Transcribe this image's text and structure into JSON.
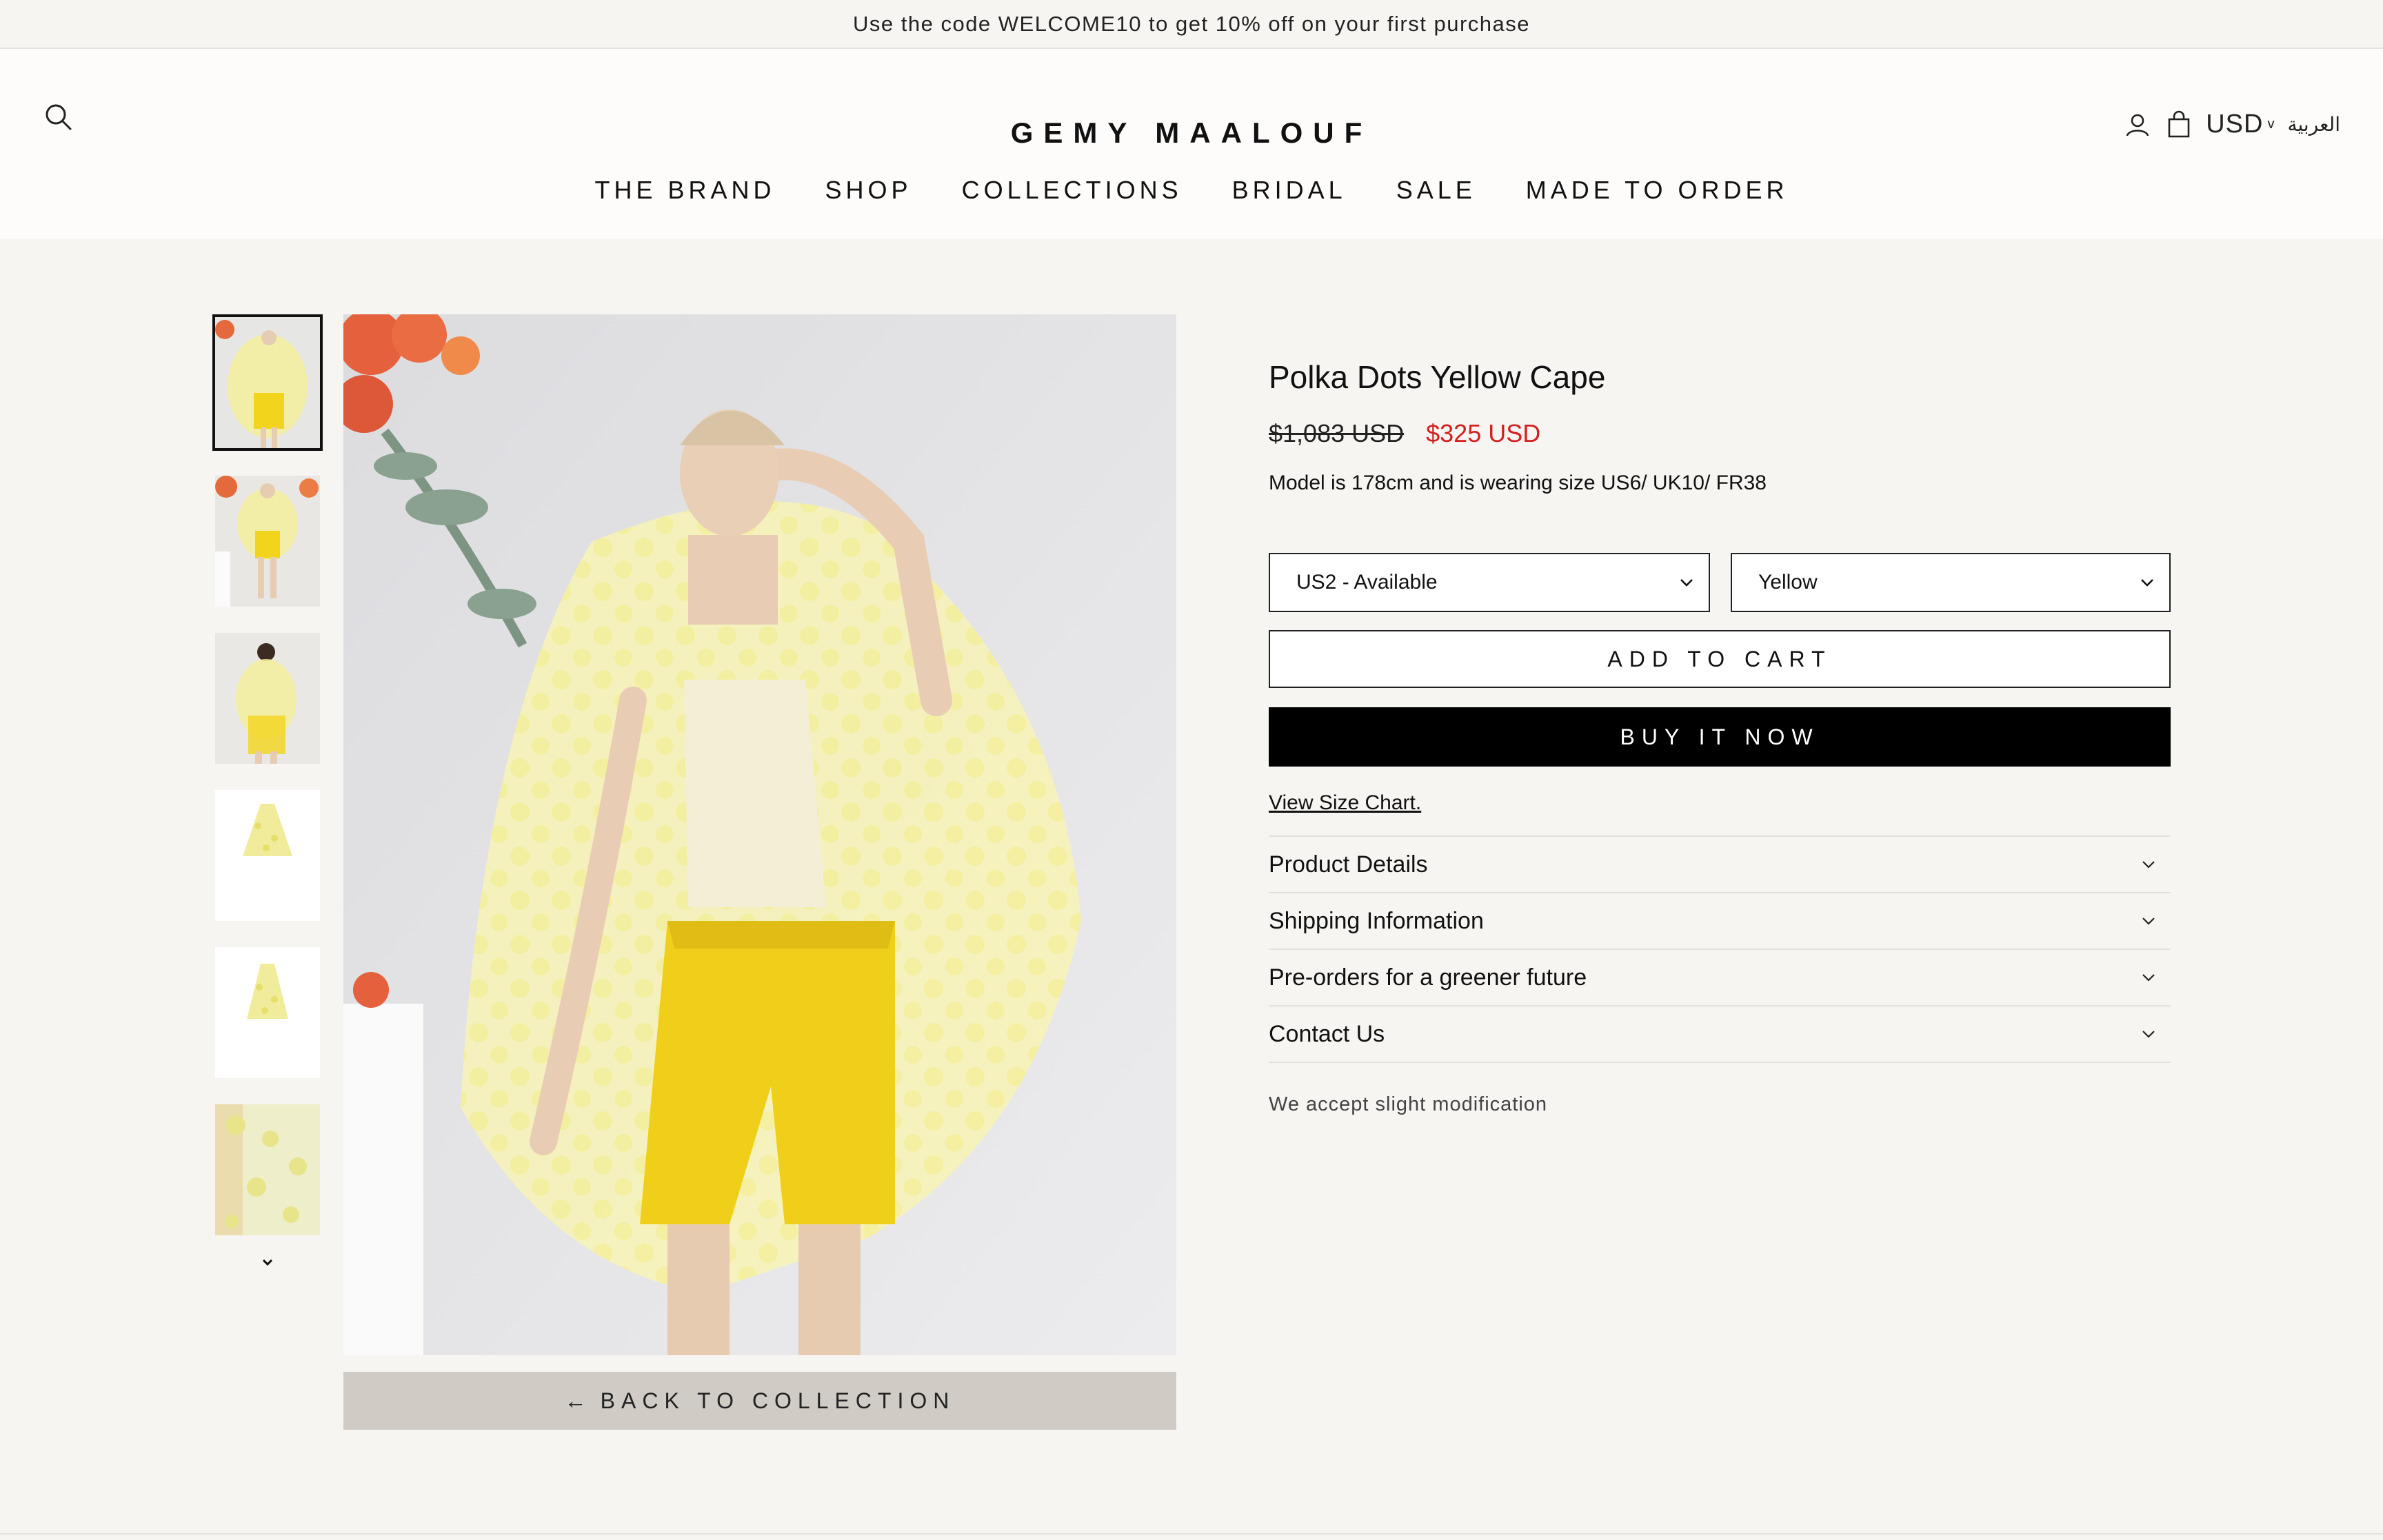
{
  "announcement": {
    "text": "Use the code WELCOME10 to get 10% off on your first purchase"
  },
  "header": {
    "logo": "GEMY MAALOUF",
    "search_icon": "search-icon",
    "account_icon": "user-icon",
    "cart_icon": "shopping-bag-icon",
    "currency": "USD",
    "currency_caret": "v",
    "language": "العربية"
  },
  "nav": {
    "items": [
      {
        "label": "THE BRAND"
      },
      {
        "label": "SHOP"
      },
      {
        "label": "COLLECTIONS"
      },
      {
        "label": "BRIDAL"
      },
      {
        "label": "SALE"
      },
      {
        "label": "MADE TO ORDER"
      }
    ]
  },
  "gallery": {
    "thumbnails_count_visible": 6,
    "active_index": 0,
    "back_label": "BACK TO COLLECTION",
    "back_arrow": "←"
  },
  "product": {
    "title": "Polka Dots Yellow Cape",
    "price_original": "$1,083 USD",
    "price_sale": "$325 USD",
    "model_note": "Model is 178cm and is wearing size US6/ UK10/ FR38",
    "size_select": {
      "value": "US2 - Available"
    },
    "color_select": {
      "value": "Yellow"
    },
    "add_to_cart_label": "ADD TO CART",
    "buy_now_label": "BUY IT NOW",
    "size_chart_label": "View Size Chart.",
    "accordion": [
      {
        "label": "Product Details"
      },
      {
        "label": "Shipping Information"
      },
      {
        "label": "Pre-orders for a greener future"
      },
      {
        "label": "Contact Us"
      }
    ],
    "modification_note": "We accept slight modification"
  },
  "colors": {
    "sale_red": "#d3201f",
    "page_bg": "#f7f5f2",
    "back_button_bg": "#d0ccc5",
    "buy_now_bg": "#000000"
  }
}
